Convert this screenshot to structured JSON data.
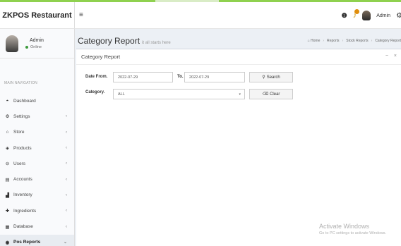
{
  "app": {
    "brand": "ZKPOS Restaurant"
  },
  "colors": {
    "accent_bar": "#8fd14f",
    "online": "#3c9a3c",
    "bell": "#c69a1a"
  },
  "navbar": {
    "menu_icon": "bars-icon",
    "info_icon": "info-icon",
    "bell_icon": "bell-icon",
    "user_name": "Admin",
    "settings_icon": "gear-icon"
  },
  "sidebar": {
    "user": {
      "name": "Admin",
      "status": "Online"
    },
    "nav_header": "MAIN NAVIGATION",
    "items": [
      {
        "label": "Dashboard",
        "icon": "dashboard-icon",
        "has_caret": false
      },
      {
        "label": "Settings",
        "icon": "gear-icon",
        "has_caret": true
      },
      {
        "label": "Store",
        "icon": "home-icon",
        "has_caret": true
      },
      {
        "label": "Products",
        "icon": "tag-icon",
        "has_caret": true
      },
      {
        "label": "Users",
        "icon": "user-icon",
        "has_caret": true
      },
      {
        "label": "Accounts",
        "icon": "ledger-icon",
        "has_caret": true
      },
      {
        "label": "Inventory",
        "icon": "chart-icon",
        "has_caret": true
      },
      {
        "label": "Ingredients",
        "icon": "plus-icon",
        "has_caret": true
      },
      {
        "label": "Database",
        "icon": "database-icon",
        "has_caret": true
      },
      {
        "label": "Pos Reports",
        "icon": "eye-icon",
        "has_caret": true,
        "active": true
      }
    ]
  },
  "page": {
    "title": "Category Report",
    "subtitle": "it all starts here",
    "breadcrumb": [
      "Home",
      "Reports",
      "Stock Reports",
      "Category Report"
    ]
  },
  "box": {
    "title": "Category Report",
    "collapse_label": "−",
    "close_label": "×",
    "date_from_label": "Date From.",
    "date_from_value": "2022-07-29",
    "to_label": "To.",
    "to_value": "2022-07-29",
    "search_label": "Search",
    "category_label": "Category.",
    "category_value": "ALL",
    "clear_label": "Clear"
  },
  "watermark": {
    "line1": "Activate Windows",
    "line2": "Go to PC settings to activate Windows."
  }
}
